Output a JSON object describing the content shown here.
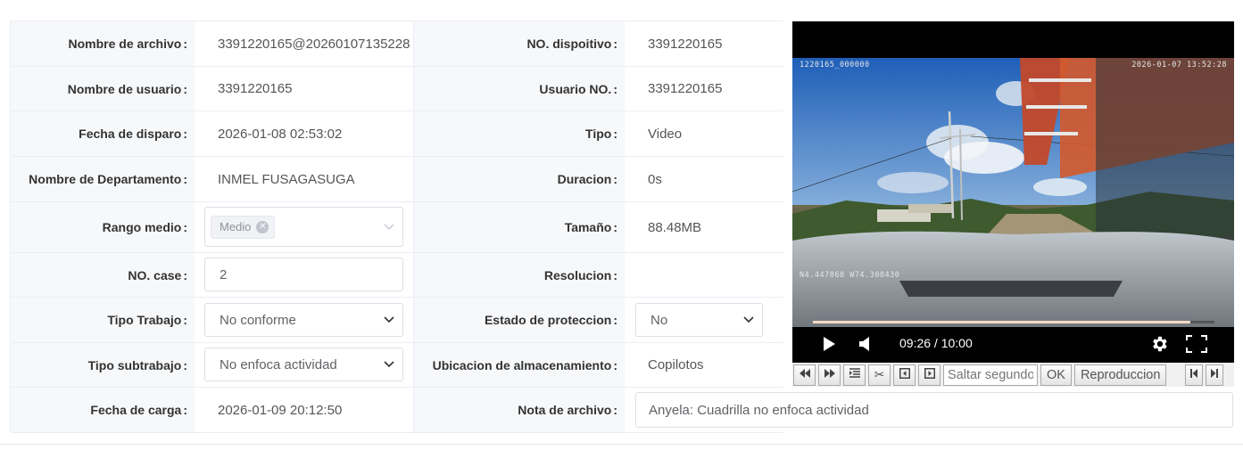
{
  "form": {
    "rows": [
      {
        "label1": "Nombre de archivo",
        "value1": "3391220165@20260107135228",
        "label2": "NO. dispoitivo",
        "value2": "3391220165"
      },
      {
        "label1": "Nombre de usuario",
        "value1": "3391220165",
        "label2": "Usuario NO.",
        "value2": "3391220165"
      },
      {
        "label1": "Fecha de disparo",
        "value1": "2026-01-08 02:53:02",
        "label2": "Tipo",
        "value2": "Video"
      },
      {
        "label1": "Nombre de Departamento",
        "value1": "INMEL FUSAGASUGA",
        "label2": "Duracion",
        "value2": "0s"
      },
      {
        "label1": "Rango medio",
        "label2": "Tamaño",
        "value2": "88.48MB"
      },
      {
        "label1": "NO. case",
        "label2": "Resolucion",
        "value2": ""
      },
      {
        "label1": "Tipo Trabajo",
        "label2": "Estado de proteccion"
      },
      {
        "label1": "Tipo subtrabajo",
        "label2": "Ubicacion de almacenamiento",
        "value2": "Copilotos"
      },
      {
        "label1": "Fecha de carga",
        "value1": "2026-01-09 20:12:50",
        "label2": "Nota de archivo"
      }
    ],
    "colon": ":",
    "rango_medio_tag": "Medio",
    "no_case_value": "2",
    "tipo_trabajo_selected": "No conforme",
    "tipo_subtrabajo_selected": "No enfoca actividad",
    "estado_proteccion_selected": "No",
    "nota_archivo_value": "Anyela: Cuadrilla no enfoca actividad"
  },
  "video": {
    "osd_left": "1220165_000000",
    "osd_timestamp": "2026-01-07 13:52:28",
    "osd_gps": "N4.447868 W74.300430",
    "time_display": "09:26 / 10:00",
    "progress": 0.94
  },
  "toolbar": {
    "seek_placeholder": "Saltar segundos",
    "ok_label": "OK",
    "playback_label": "Reproduccion"
  },
  "icons": [
    "rewind-icon",
    "fast-forward-icon",
    "list-icon",
    "scissors-icon",
    "frame-back-icon",
    "frame-forward-icon",
    "play-icon",
    "volume-icon",
    "gear-icon",
    "fullscreen-icon",
    "skip-start-icon",
    "skip-end-icon",
    "chevron-down-icon",
    "close-icon"
  ]
}
